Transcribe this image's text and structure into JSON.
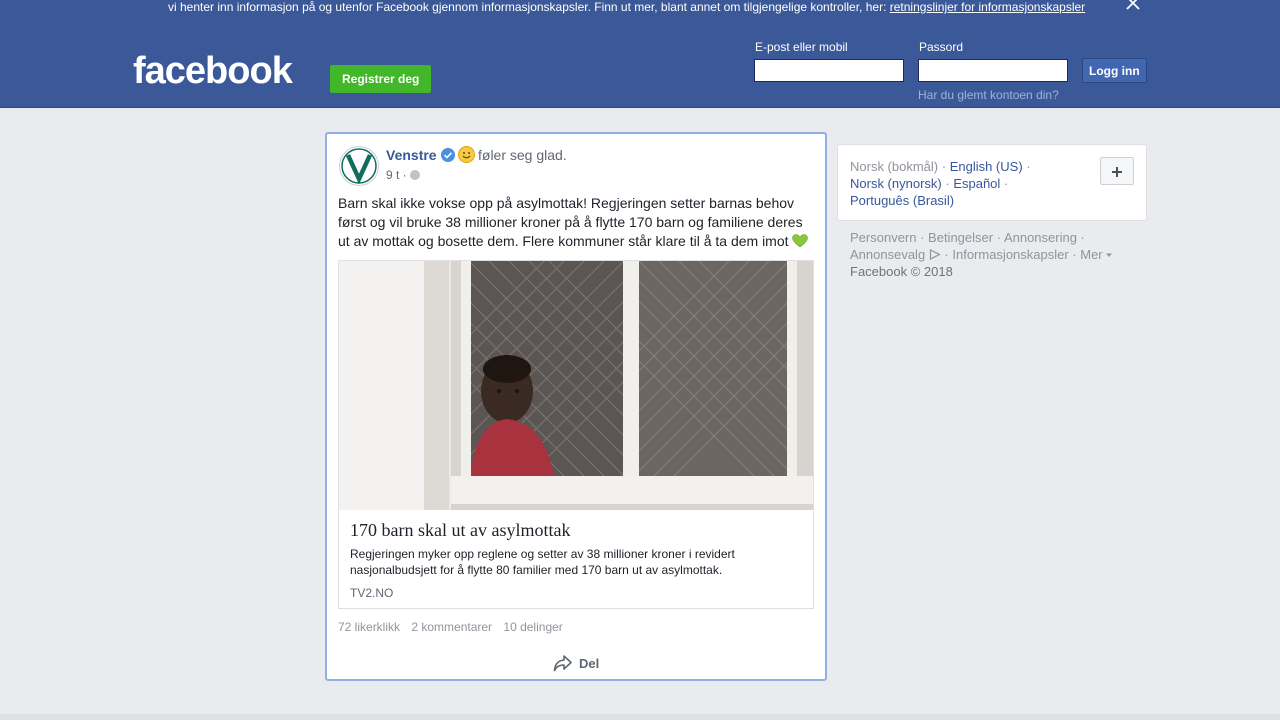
{
  "cookie_bar": {
    "text": "vi henter inn informasjon på og utenfor Facebook gjennom informasjonskapsler. Finn ut mer, blant annet om tilgjengelige kontroller, her: ",
    "link": "retningslinjer for informasjonskapsler"
  },
  "header": {
    "logo": "facebook",
    "register": "Registrer deg",
    "email_label": "E-post eller mobil",
    "password_label": "Passord",
    "email_value": "",
    "password_value": "",
    "login": "Logg inn",
    "forgot": "Har du glemt kontoen din?"
  },
  "post": {
    "author": "Venstre",
    "feeling": "føler seg glad.",
    "time": "9 t ·",
    "text": "Barn skal ikke vokse opp på asylmottak! Regjeringen setter barnas behov først og vil bruke 38 millioner kroner på å flytte 170 barn og familiene deres ut av mottak og bosette dem. Flere kommuner står klare til å ta dem imot",
    "link": {
      "title": "170 barn skal ut av asylmottak",
      "description": "Regjeringen myker opp reglene og setter av 38 millioner kroner i revidert nasjonalbudsjett for å flytte 80 familier med 170 barn ut av asylmottak.",
      "domain": "TV2.NO"
    },
    "likes": "72 likerklikk",
    "comments": "2 kommentarer",
    "shares": "10 delinger",
    "share_button": "Del"
  },
  "languages": {
    "current": "Norsk (bokmål)",
    "options": [
      "English (US)",
      "Norsk (nynorsk)",
      "Español",
      "Português (Brasil)"
    ]
  },
  "footer": {
    "links": [
      "Personvern",
      "Betingelser",
      "Annonsering",
      "Annonsevalg",
      "Informasjonskapsler",
      "Mer"
    ],
    "copyright": "Facebook © 2018"
  },
  "colors": {
    "brand": "#3b5998",
    "register_green": "#42b72a",
    "link_blue": "#385898"
  }
}
